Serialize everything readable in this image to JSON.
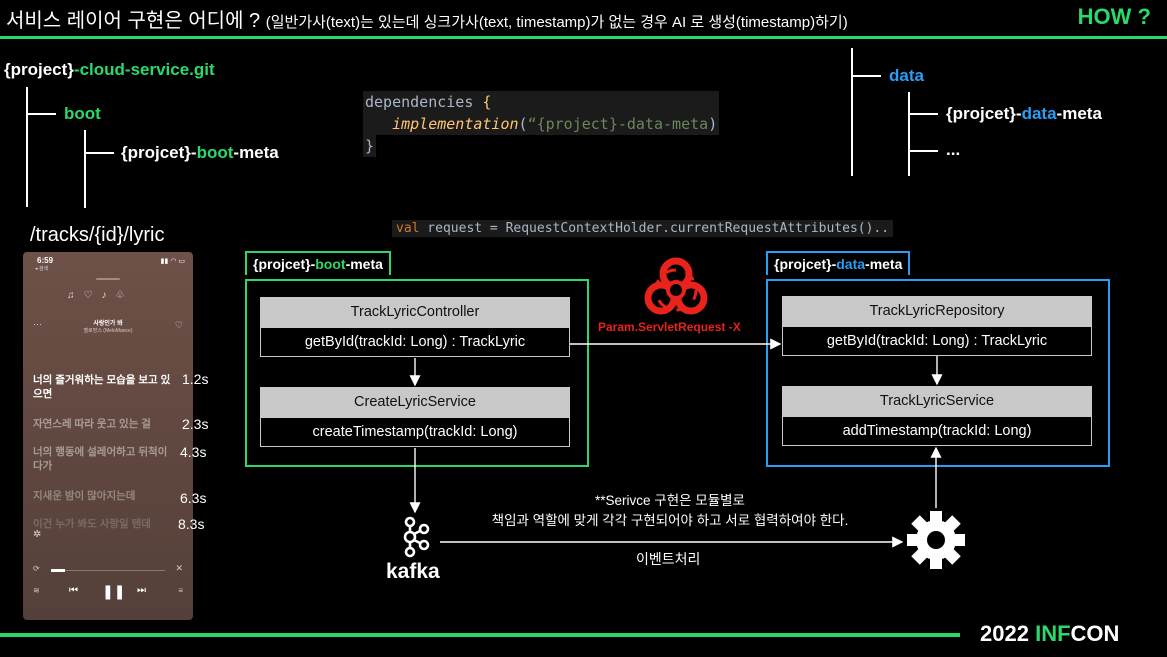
{
  "header": {
    "title": "서비스 레이어 구현은 어디에 ?",
    "subtitle": "(일반가사(text)는 있는데 싱크가사(text, timestamp)가 없는 경우 AI 로 생성(timestamp)하기)",
    "how": "HOW ?"
  },
  "repo_tree": {
    "root_prefix": "{project}",
    "root_suffix": "-cloud-service.git",
    "boot": "boot",
    "boot_module_prefix": "{projcet}-",
    "boot_module_mid": "boot",
    "boot_module_suffix": "-meta"
  },
  "code_block": {
    "line1_kw": "dependencies",
    "line1_brace": " {",
    "line2_fn": "implementation",
    "line2_paren_open": "(",
    "line2_str": "“{project}-data-meta",
    "line2_paren_close": ")",
    "line3": "}"
  },
  "data_tree": {
    "data": "data",
    "module_prefix": "{projcet}-",
    "module_mid": "data",
    "module_suffix": "-meta",
    "ellipsis": "..."
  },
  "route": "/tracks/{id}/lyric",
  "request_code": {
    "kw": "val",
    "rest": " request = RequestContextHolder.currentRequestAttributes().."
  },
  "phone": {
    "time": "6:59",
    "back": "◂ 검색",
    "song_title": "사랑인가 봐",
    "song_artist": "멜로망스 (MeloMance)",
    "lyrics": [
      "너의 즐거워하는 모습을 보고 있으면",
      "자연스레 따라 웃고 있는 걸",
      "너의 행동에 설레어하고 뒤척이다가",
      "지새운 밤이 많아지는데",
      "이건 누가 봐도 사랑일 텐데"
    ]
  },
  "timings": [
    "1.2s",
    "2.3s",
    "4.3s",
    "6.3s",
    "8.3s"
  ],
  "boot_module": {
    "tag_prefix": "{projcet}-",
    "tag_mid": "boot",
    "tag_suffix": "-meta",
    "controller": {
      "name": "TrackLyricController",
      "method": "getById(trackId: Long) : TrackLyric"
    },
    "service": {
      "name": "CreateLyricService",
      "method": "createTimestamp(trackId: Long)"
    }
  },
  "data_module": {
    "tag_prefix": "{projcet}-",
    "tag_mid": "data",
    "tag_suffix": "-meta",
    "repository": {
      "name": "TrackLyricRepository",
      "method": "getById(trackId: Long) : TrackLyric"
    },
    "service": {
      "name": "TrackLyricService",
      "method": "addTimestamp(trackId: Long)"
    }
  },
  "biohazard_label": "Param.ServletRequest -X",
  "note": {
    "line1": "**Serivce 구현은 모듈별로",
    "line2": "책임과 역할에 맞게 각각 구현되어야 하고 서로 협력하여야 한다."
  },
  "event_label": "이벤트처리",
  "kafka_label": "kafka",
  "footer": {
    "year": "2022",
    "inf": "INF",
    "con": "CON"
  },
  "colors": {
    "green": "#2bd96a",
    "blue": "#2a9df4",
    "red": "#e8231c"
  },
  "icons": [
    "biohazard-icon",
    "kafka-icon",
    "gear-icon"
  ]
}
